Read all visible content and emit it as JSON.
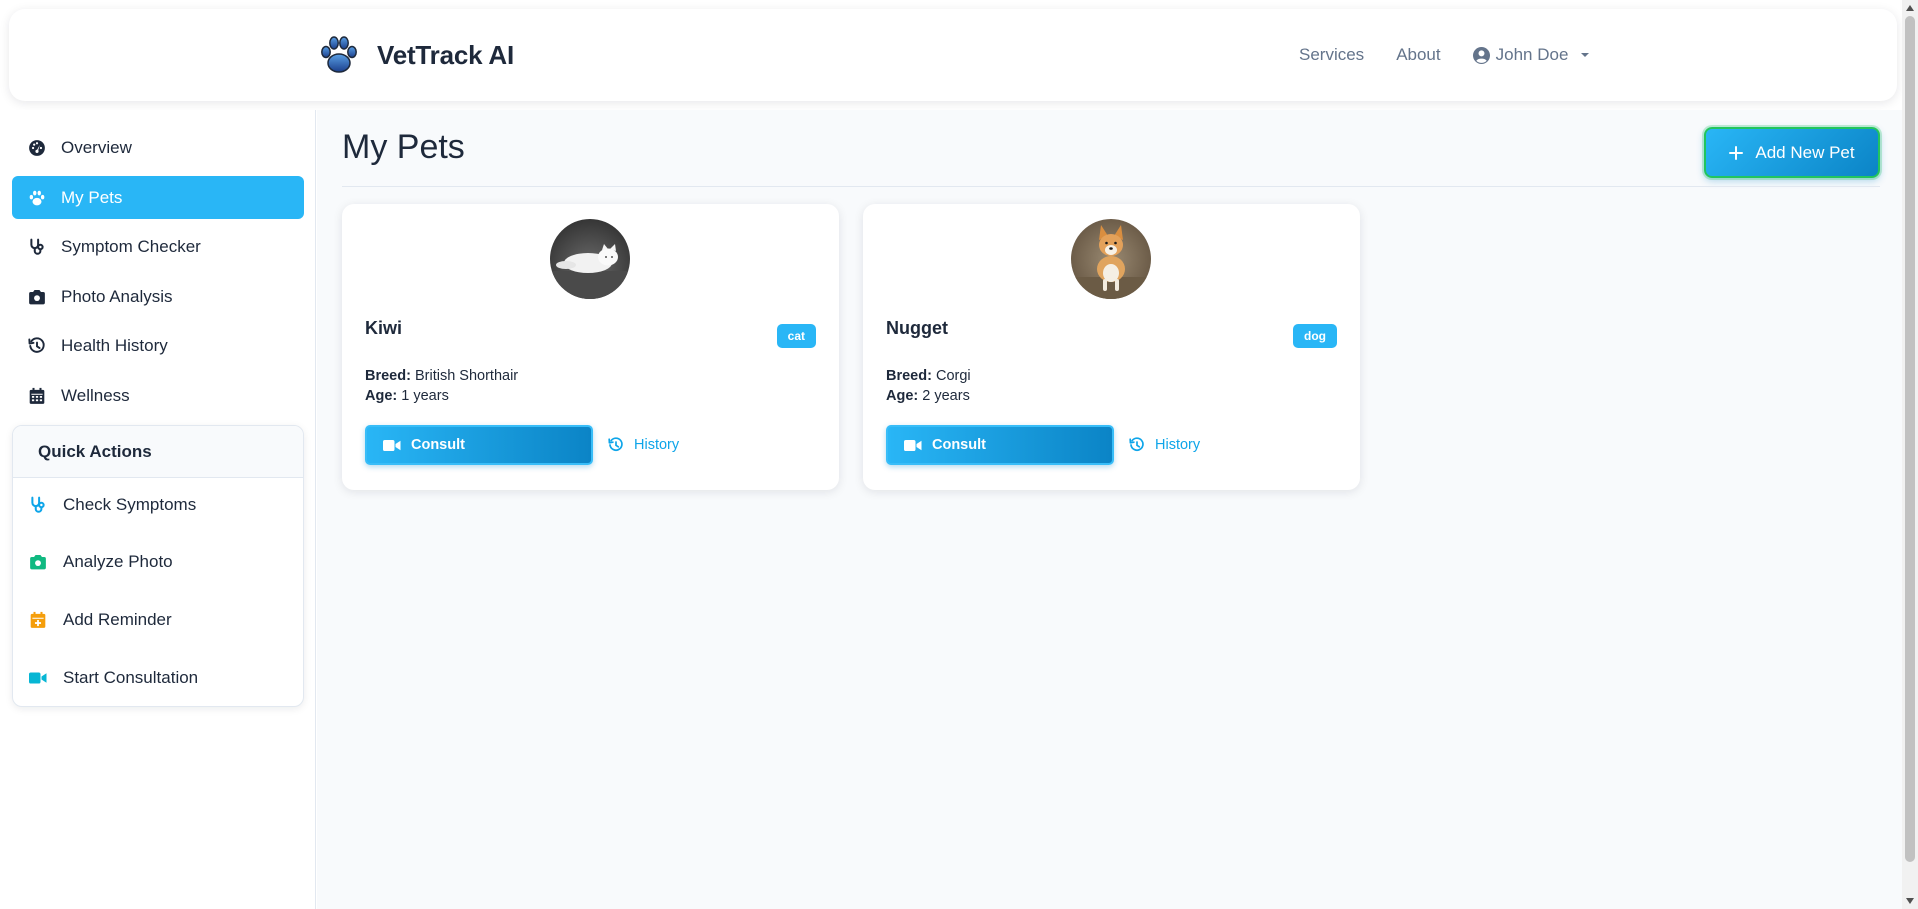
{
  "navbar": {
    "brand_name": "VetTrack AI",
    "links": {
      "services": "Services",
      "about": "About"
    },
    "user_name": "John Doe"
  },
  "sidebar": {
    "items": [
      {
        "label": "Overview",
        "icon": "dashboard-icon",
        "active": false
      },
      {
        "label": "My Pets",
        "icon": "paw-icon",
        "active": true
      },
      {
        "label": "Symptom Checker",
        "icon": "stethoscope-icon",
        "active": false
      },
      {
        "label": "Photo Analysis",
        "icon": "camera-icon",
        "active": false
      },
      {
        "label": "Health History",
        "icon": "history-icon",
        "active": false
      },
      {
        "label": "Wellness",
        "icon": "calendar-icon",
        "active": false
      }
    ],
    "quick_actions": {
      "title": "Quick Actions",
      "items": [
        {
          "label": "Check Symptoms",
          "icon": "stethoscope-icon",
          "color": "#0ea5e9"
        },
        {
          "label": "Analyze Photo",
          "icon": "camera-icon",
          "color": "#10b981"
        },
        {
          "label": "Add Reminder",
          "icon": "calendar-plus-icon",
          "color": "#f59e0b"
        },
        {
          "label": "Start Consultation",
          "icon": "video-icon",
          "color": "#06b6d4"
        }
      ]
    }
  },
  "main": {
    "title": "My Pets",
    "add_button_label": "Add New Pet",
    "pets": [
      {
        "name": "Kiwi",
        "species": "cat",
        "breed_label": "Breed:",
        "breed": "British Shorthair",
        "age_label": "Age:",
        "age": "1 years",
        "consult_label": "Consult",
        "history_label": "History"
      },
      {
        "name": "Nugget",
        "species": "dog",
        "breed_label": "Breed:",
        "breed": "Corgi",
        "age_label": "Age:",
        "age": "2 years",
        "consult_label": "Consult",
        "history_label": "History"
      }
    ]
  },
  "colors": {
    "accent": "#29b6f6",
    "accent_dark": "#0b84c6",
    "link": "#0ea5e9",
    "focus_ring": "#22c55e",
    "text": "#1e293b",
    "muted": "#64748b",
    "main_bg": "#f8fafc"
  }
}
